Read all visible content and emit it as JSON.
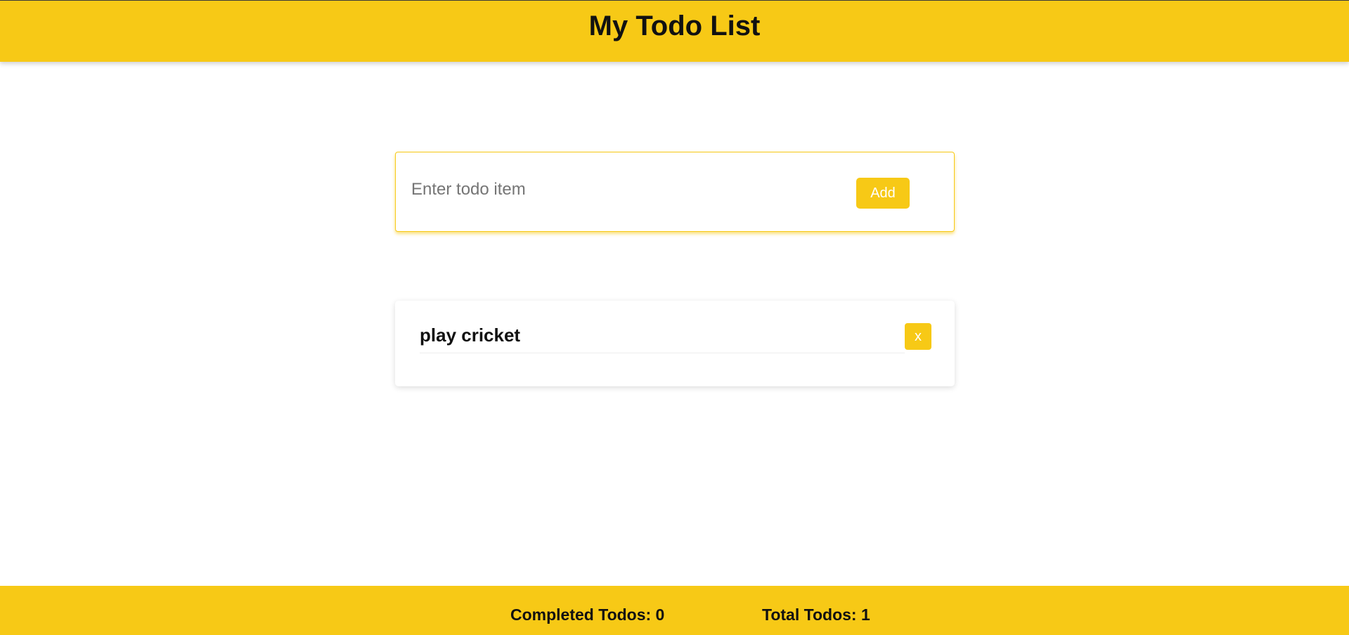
{
  "header": {
    "title": "My Todo List"
  },
  "input_card": {
    "placeholder": "Enter todo item",
    "value": "",
    "add_label": "Add"
  },
  "todos": [
    {
      "text": "play cricket",
      "delete_label": "x"
    }
  ],
  "footer": {
    "completed_label": "Completed Todos: 0",
    "total_label": "Total Todos: 1"
  },
  "colors": {
    "accent": "#f7c916",
    "text": "#111111",
    "placeholder": "#757575"
  }
}
